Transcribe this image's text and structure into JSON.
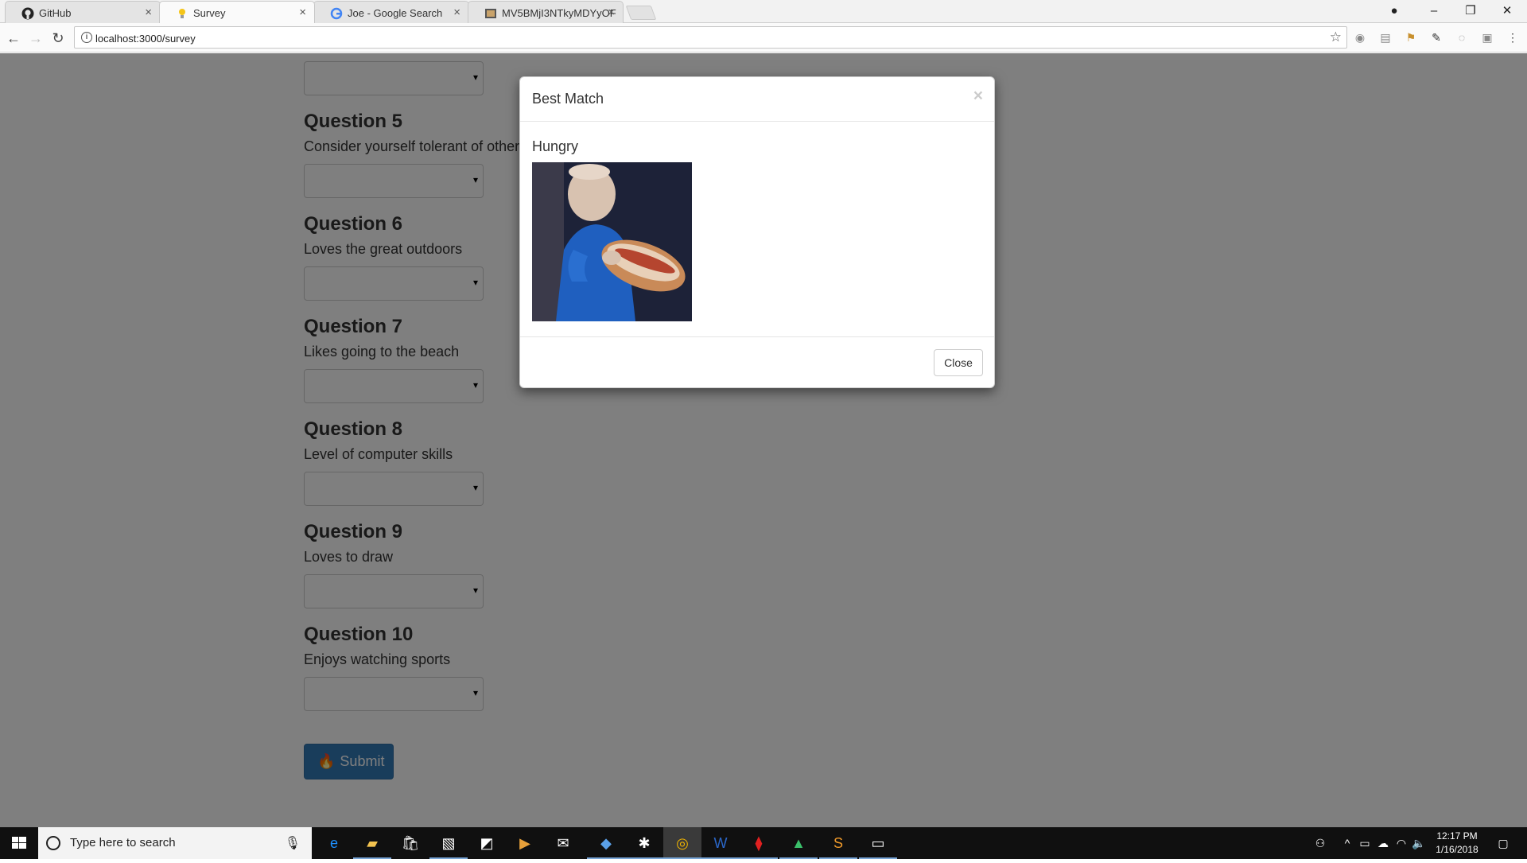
{
  "browser": {
    "tabs": [
      {
        "title": "GitHub",
        "icon": "github-icon",
        "active": false
      },
      {
        "title": "Survey",
        "icon": "lightbulb-icon",
        "active": true
      },
      {
        "title": "Joe - Google Search",
        "icon": "google-icon",
        "active": false
      },
      {
        "title": "MV5BMjI3NTkyMDYyOF",
        "icon": "image-icon",
        "active": false
      }
    ],
    "url": "localhost:3000/survey"
  },
  "survey": {
    "questions": [
      {
        "title": "Question 5",
        "text": "Consider yourself tolerant of other"
      },
      {
        "title": "Question 6",
        "text": "Loves the great outdoors"
      },
      {
        "title": "Question 7",
        "text": "Likes going to the beach"
      },
      {
        "title": "Question 8",
        "text": "Level of computer skills"
      },
      {
        "title": "Question 9",
        "text": "Loves to draw"
      },
      {
        "title": "Question 10",
        "text": "Enjoys watching sports"
      }
    ],
    "submit_label": "Submit"
  },
  "modal": {
    "title": "Best Match",
    "close_x": "×",
    "match_name": "Hungry",
    "close_label": "Close"
  },
  "taskbar": {
    "search_placeholder": "Type here to search",
    "time": "12:17 PM",
    "date": "1/16/2018"
  },
  "colors": {
    "primary": "#337ab7",
    "backdrop": "rgba(0,0,0,0.5)"
  }
}
